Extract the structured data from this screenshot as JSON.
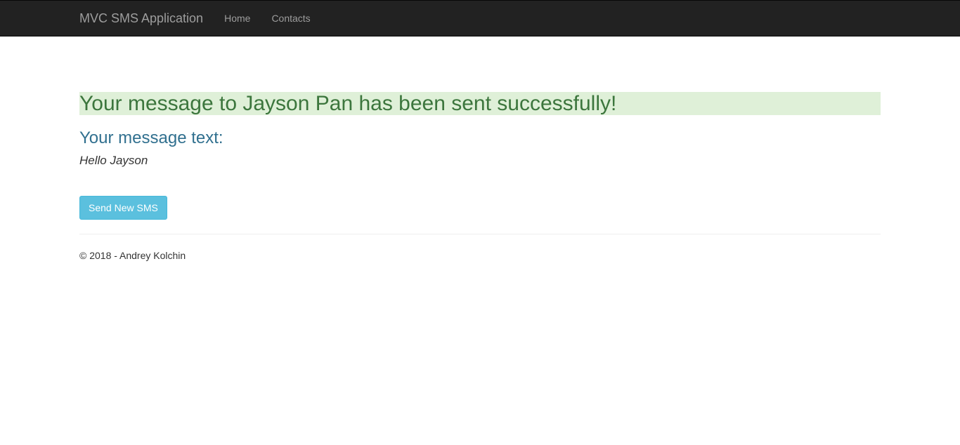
{
  "navbar": {
    "brand": "MVC SMS Application",
    "links": [
      {
        "label": "Home"
      },
      {
        "label": "Contacts"
      }
    ]
  },
  "main": {
    "success_message": "Your message to Jayson Pan has been sent successfully!",
    "message_label": "Your message text:",
    "message_text": "Hello Jayson",
    "send_new_button": "Send New SMS"
  },
  "footer": {
    "copyright": "© 2018 - Andrey Kolchin"
  },
  "colors": {
    "navbar_bg": "#222222",
    "success_bg": "#dff0d8",
    "success_text": "#3c763d",
    "info_text": "#31708f",
    "button_bg": "#5bc0de"
  }
}
